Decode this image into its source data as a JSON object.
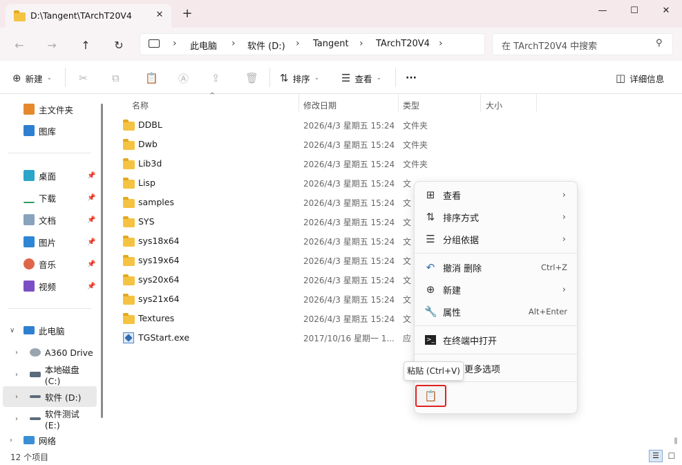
{
  "window": {
    "tab_title": "D:\\Tangent\\TArchT20V4",
    "close_tab_glyph": "✕",
    "new_tab_glyph": "+",
    "minimize_glyph": "—",
    "maximize_glyph": "☐",
    "close_glyph": "✕"
  },
  "nav": {
    "back_glyph": "←",
    "forward_glyph": "→",
    "up_glyph": "↑",
    "refresh_glyph": "↻",
    "breadcrumbs": [
      "此电脑",
      "软件 (D:)",
      "Tangent",
      "TArchT20V4"
    ],
    "sep_glyph": "›",
    "search_placeholder": "在 TArchT20V4 中搜索"
  },
  "toolbar": {
    "new_label": "新建",
    "sort_label": "排序",
    "view_label": "查看",
    "more_glyph": "···",
    "details_label": "详细信息"
  },
  "sidebar": {
    "home": "主文件夹",
    "gallery": "图库",
    "quick": [
      "桌面",
      "下载",
      "文档",
      "图片",
      "音乐",
      "视频"
    ],
    "this_pc": "此电脑",
    "drives": [
      "A360 Drive",
      "本地磁盘 (C:)",
      "软件 (D:)",
      "软件测试 (E:)"
    ],
    "network": "网络"
  },
  "columns": {
    "name": "名称",
    "date": "修改日期",
    "type": "类型",
    "size": "大小"
  },
  "files": [
    {
      "name": "DDBL",
      "date": "2026/4/3 星期五 15:24",
      "type": "文件夹",
      "kind": "folder"
    },
    {
      "name": "Dwb",
      "date": "2026/4/3 星期五 15:24",
      "type": "文件夹",
      "kind": "folder"
    },
    {
      "name": "Lib3d",
      "date": "2026/4/3 星期五 15:24",
      "type": "文件夹",
      "kind": "folder"
    },
    {
      "name": "Lisp",
      "date": "2026/4/3 星期五 15:24",
      "type": "文",
      "kind": "folder"
    },
    {
      "name": "samples",
      "date": "2026/4/3 星期五 15:24",
      "type": "文",
      "kind": "folder"
    },
    {
      "name": "SYS",
      "date": "2026/4/3 星期五 15:24",
      "type": "文",
      "kind": "folder"
    },
    {
      "name": "sys18x64",
      "date": "2026/4/3 星期五 15:24",
      "type": "文",
      "kind": "folder"
    },
    {
      "name": "sys19x64",
      "date": "2026/4/3 星期五 15:24",
      "type": "文",
      "kind": "folder"
    },
    {
      "name": "sys20x64",
      "date": "2026/4/3 星期五 15:24",
      "type": "文",
      "kind": "folder"
    },
    {
      "name": "sys21x64",
      "date": "2026/4/3 星期五 15:24",
      "type": "文",
      "kind": "folder"
    },
    {
      "name": "Textures",
      "date": "2026/4/3 星期五 15:24",
      "type": "文",
      "kind": "folder"
    },
    {
      "name": "TGStart.exe",
      "date": "2017/10/16 星期一 1...",
      "type": "应",
      "kind": "exe"
    }
  ],
  "context_menu": {
    "view": "查看",
    "sort": "排序方式",
    "group": "分组依据",
    "undo": "撤消 删除",
    "undo_shortcut": "Ctrl+Z",
    "new": "新建",
    "properties": "属性",
    "properties_shortcut": "Alt+Enter",
    "terminal": "在终端中打开",
    "more_options": "更多选项",
    "paste_tooltip": "粘贴 (Ctrl+V)"
  },
  "status": {
    "item_count": "12 个项目"
  },
  "colors": {
    "titlebar_bg": "#f6e9ec",
    "folder_yellow": "#f5c342",
    "highlight_red": "#e02020",
    "selection_bg": "#e9e9e9"
  }
}
